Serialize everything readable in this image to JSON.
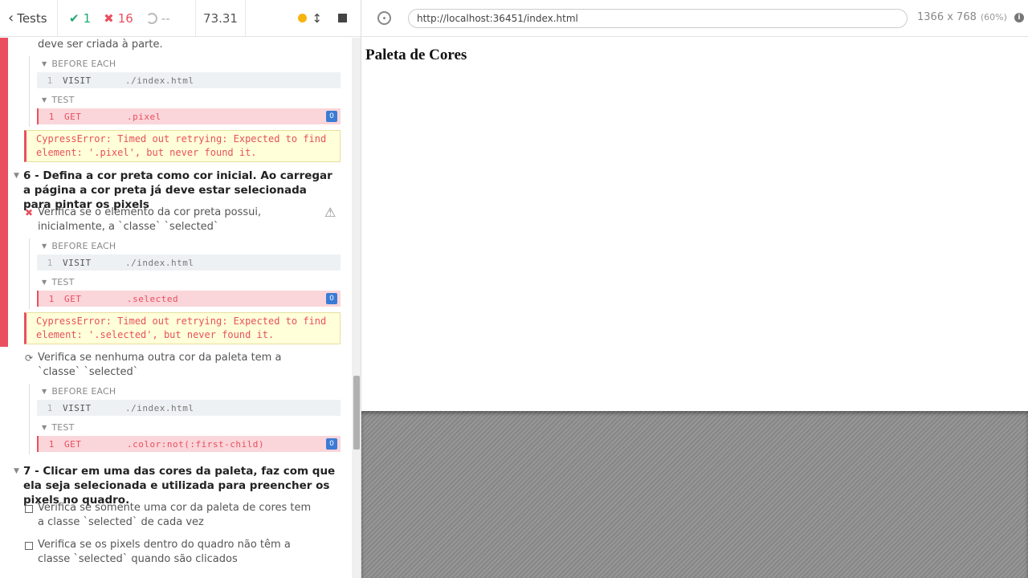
{
  "topbar": {
    "back_label": "Tests",
    "passed": "1",
    "failed": "16",
    "pending": "--",
    "duration": "73.31"
  },
  "reporter": {
    "truncated_test_tail": "deve ser criada à parte.",
    "block1": {
      "before_each": "BEFORE EACH",
      "visit_num": "1",
      "visit_name": "VISIT",
      "visit_msg": "./index.html",
      "test": "TEST",
      "get_num": "1",
      "get_name": "GET",
      "get_msg": ".pixel",
      "get_count": "0",
      "error": "CypressError: Timed out retrying: Expected to find element: '.pixel', but never found it."
    },
    "suite6": {
      "title": "6 - Defina a cor preta como cor inicial. Ao carregar a página a cor preta já deve estar selecionada para pintar os pixels",
      "test1": {
        "title": "Verifica se o elemento da cor preta possui, inicialmente, a `classe` `selected`",
        "before_each": "BEFORE EACH",
        "visit_num": "1",
        "visit_name": "VISIT",
        "visit_msg": "./index.html",
        "test": "TEST",
        "get_num": "1",
        "get_name": "GET",
        "get_msg": ".selected",
        "get_count": "0",
        "error": "CypressError: Timed out retrying: Expected to find element: '.selected', but never found it."
      },
      "test2": {
        "title": "Verifica se nenhuma outra cor da paleta tem a `classe` `selected`",
        "before_each": "BEFORE EACH",
        "visit_num": "1",
        "visit_name": "VISIT",
        "visit_msg": "./index.html",
        "test": "TEST",
        "get_num": "1",
        "get_name": "GET",
        "get_msg": ".color:not(:first-child)",
        "get_count": "0"
      }
    },
    "suite7": {
      "title": "7 - Clicar em uma das cores da paleta, faz com que ela seja selecionada e utilizada para preencher os pixels no quadro.",
      "test1": "Verifica se somente uma cor da paleta de cores tem a classe `selected` de cada vez",
      "test2": "Verifica se os pixels dentro do quadro não têm a classe `selected` quando são clicados"
    }
  },
  "app": {
    "url": "http://localhost:36451/index.html",
    "viewport_size": "1366 x 768",
    "viewport_scale": "(60%)",
    "page_title": "Paleta de Cores"
  },
  "colors": {
    "fail": "#e94f5f",
    "pass": "#1fa971",
    "badge": "#3a7bd5",
    "error_bg": "#ffffd9"
  }
}
